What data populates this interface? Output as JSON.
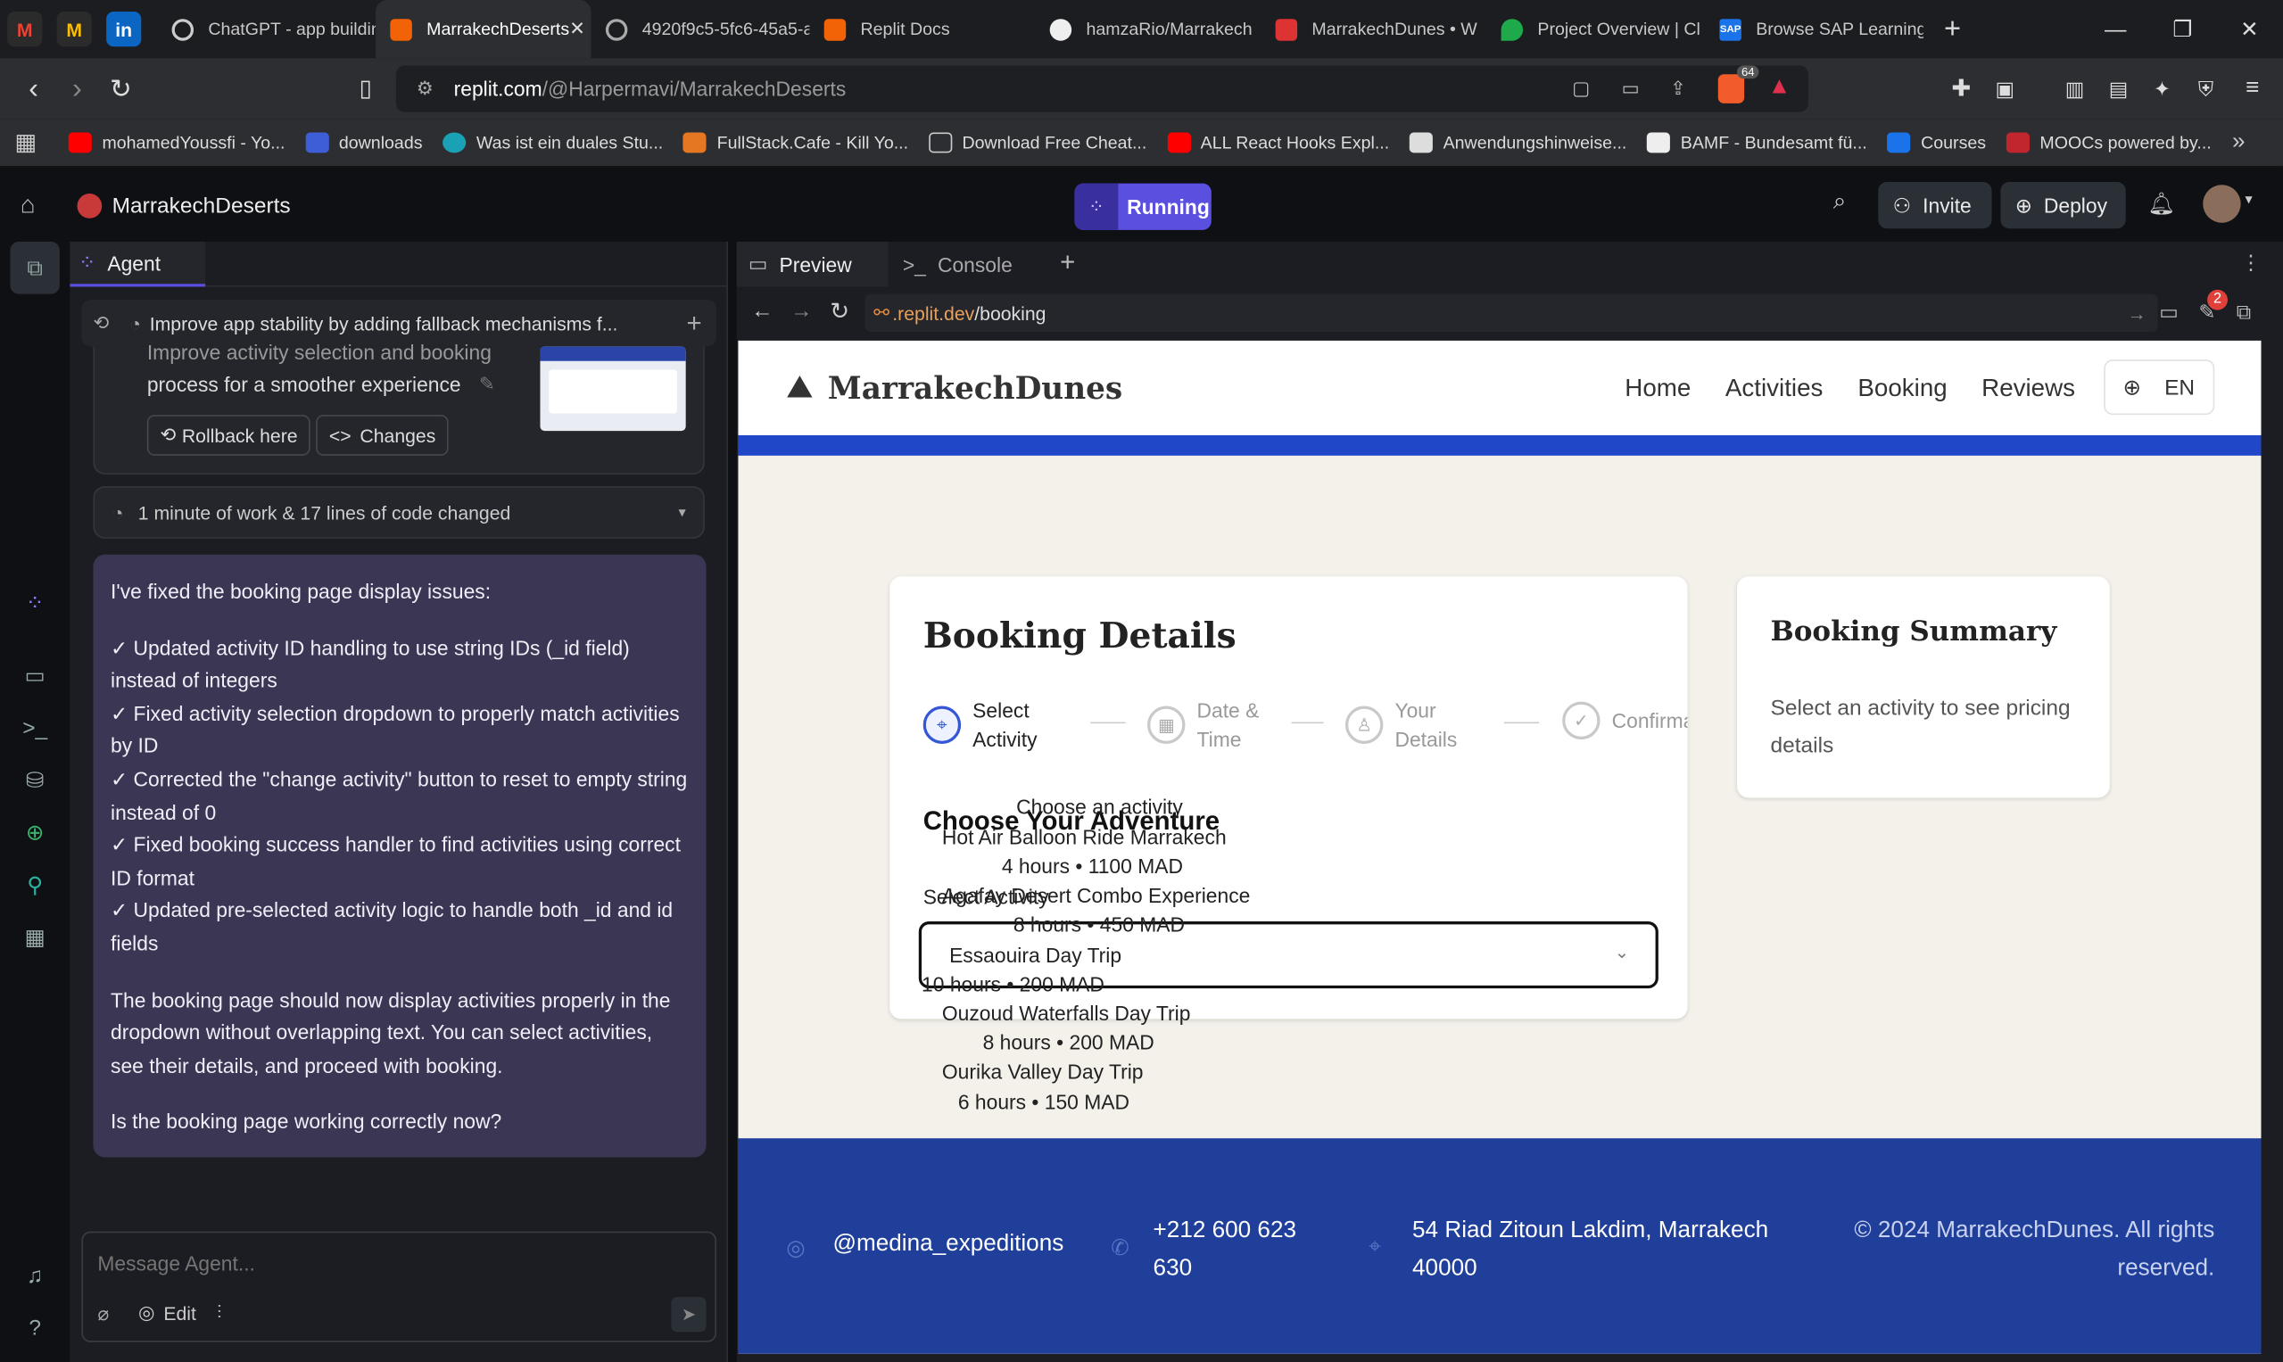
{
  "browser": {
    "tabs": [
      {
        "label": "ChatGPT - app buildin"
      },
      {
        "label": "MarrakechDeserts"
      },
      {
        "label": "4920f9c5-5fc6-45a5-a"
      },
      {
        "label": "Replit Docs"
      },
      {
        "label": "hamzaRio/Marrakech"
      },
      {
        "label": "MarrakechDunes • W"
      },
      {
        "label": "Project Overview | Cl"
      },
      {
        "label": "Browse SAP Learning"
      }
    ],
    "url_host": "replit.com",
    "url_path": "/@Harpermavi/MarrakechDeserts",
    "brave_badge": "64",
    "bookmarks": [
      "mohamedYoussfi - Yo...",
      "downloads",
      "Was ist ein duales Stu...",
      "FullStack.Cafe - Kill Yo...",
      "Download Free Cheat...",
      "ALL React Hooks Expl...",
      "Anwendungshinweise...",
      "BAMF - Bundesamt fü...",
      "Courses",
      "MOOCs powered by..."
    ]
  },
  "replit": {
    "project_name": "MarrakechDeserts",
    "status": "Running",
    "invite_label": "Invite",
    "deploy_label": "Deploy"
  },
  "agent": {
    "tab_label": "Agent",
    "thread_title": "Improve app stability by adding fallback mechanisms f...",
    "checkpoint_text_line1": "Improve activity selection and booking",
    "checkpoint_text_line2": "process for a smoother experience",
    "rollback_label": "Rollback here",
    "changes_label": "Changes",
    "work_summary": "1 minute of work & 17 lines of code changed",
    "message": {
      "intro": "I've fixed the booking page display issues:",
      "items": [
        "✓ Updated activity ID handling to use string IDs (_id field) instead of integers",
        "✓ Fixed activity selection dropdown to properly match activities by ID",
        "✓ Corrected the \"change activity\" button to reset to empty string instead of 0",
        "✓ Fixed booking success handler to find activities using correct ID format",
        "✓ Updated pre-selected activity logic to handle both _id and id fields"
      ],
      "para": "The booking page should now display activities properly in the dropdown without overlapping text. You can select activities, see their details, and proceed with booking.",
      "question": "Is the booking page working correctly now?"
    },
    "input_placeholder": "Message Agent...",
    "edit_label": "Edit"
  },
  "preview": {
    "tab_preview": "Preview",
    "tab_console": "Console",
    "url_host": ".replit.dev",
    "url_path": "/booking",
    "badge": "2"
  },
  "site": {
    "brand": "MarrakechDunes",
    "nav": [
      "Home",
      "Activities",
      "Booking",
      "Reviews"
    ],
    "lang": "EN",
    "booking_title": "Booking Details",
    "steps": [
      {
        "line1": "Select",
        "line2": "Activity"
      },
      {
        "line1": "Date &",
        "line2": "Time"
      },
      {
        "line1": "Your",
        "line2": "Details"
      },
      {
        "line1": "Confirmation",
        "line2": ""
      }
    ],
    "choose_heading": "Choose Your Adventure",
    "select_label": "Select Activity",
    "dropdown_placeholder": "Choose an activity",
    "options": [
      {
        "name": "Hot Air Balloon Ride Marrakech",
        "meta": "4 hours • 1100 MAD"
      },
      {
        "name": "Agafay Desert Combo Experience",
        "meta": "8 hours • 450 MAD"
      },
      {
        "name": "Essaouira Day Trip",
        "meta": "10 hours • 200 MAD"
      },
      {
        "name": "Ouzoud Waterfalls Day Trip",
        "meta": "8 hours • 200 MAD"
      },
      {
        "name": "Ourika Valley Day Trip",
        "meta": "6 hours • 150 MAD"
      }
    ],
    "summary_title": "Booking Summary",
    "summary_text": "Select an activity to see pricing details",
    "footer": {
      "instagram": "@medina_expeditions",
      "phone": "+212 600 623 630",
      "address": "54 Riad Zitoun Lakdim, Marrakech 40000",
      "copyright": "© 2024 MarrakechDunes. All rights reserved."
    }
  },
  "colors": {
    "accent": "#5b4fe0",
    "site_blue": "#1f3f9a",
    "site_bg": "#f3f1ea",
    "agent_msg": "#3b3653"
  }
}
